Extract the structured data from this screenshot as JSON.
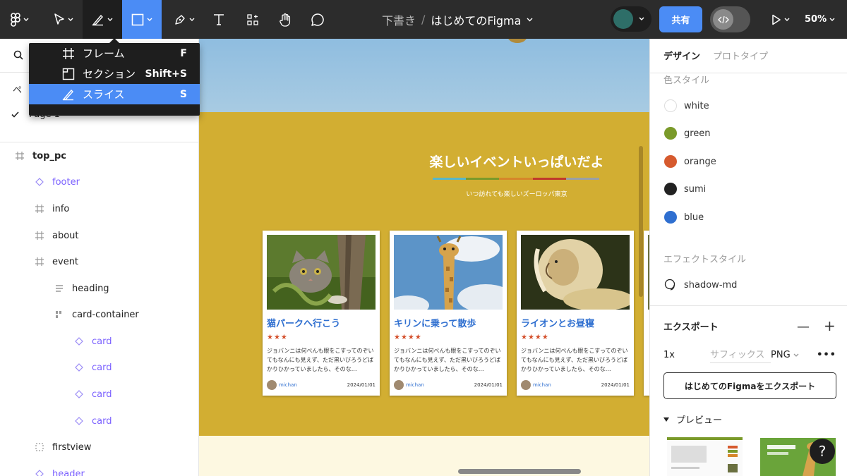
{
  "toolbar": {
    "breadcrumb_draft": "下書き",
    "breadcrumb_sep": "/",
    "file_name": "はじめてのFigma",
    "share_label": "共有",
    "zoom": "50%"
  },
  "tool_menu": {
    "items": [
      {
        "label": "フレーム",
        "shortcut": "F",
        "icon": "frame-icon"
      },
      {
        "label": "セクション",
        "shortcut": "Shift+S",
        "icon": "section-icon"
      },
      {
        "label": "スライス",
        "shortcut": "S",
        "icon": "slice-icon",
        "selected": true
      }
    ]
  },
  "left_panel": {
    "pages_label": "ペ",
    "current_page": "Page 1",
    "layers": [
      {
        "name": "top_pc",
        "type": "frame"
      },
      {
        "name": "footer",
        "type": "component"
      },
      {
        "name": "info",
        "type": "frame"
      },
      {
        "name": "about",
        "type": "frame"
      },
      {
        "name": "event",
        "type": "frame"
      },
      {
        "name": "heading",
        "type": "autolayout-vertical"
      },
      {
        "name": "card-container",
        "type": "autolayout-grid"
      },
      {
        "name": "card",
        "type": "component"
      },
      {
        "name": "card",
        "type": "component"
      },
      {
        "name": "card",
        "type": "component"
      },
      {
        "name": "card",
        "type": "component"
      },
      {
        "name": "firstview",
        "type": "group"
      },
      {
        "name": "header",
        "type": "component"
      }
    ]
  },
  "canvas": {
    "event_title": "楽しいイベントいっぱいだよ",
    "event_subtitle": "いつ訪れても楽しいズーロッパ東京",
    "cards": [
      {
        "title": "猫パークへ行こう",
        "stars": "★★★",
        "body": "ジョバンニは何べんも眼をこすってのぞいてもなんにも見えず、ただ黒いびろうどばかりひかっていましたら、そのな…",
        "user": "michan",
        "date": "2024/01/01",
        "image": "kitten"
      },
      {
        "title": "キリンに乗って散歩",
        "stars": "★★★★",
        "body": "ジョバンニは何べんも眼をこすってのぞいてもなんにも見えず、ただ黒いびろうどばかりひかっていましたら、そのな…",
        "user": "michan",
        "date": "2024/01/01",
        "image": "giraffe"
      },
      {
        "title": "ライオンとお昼寝",
        "stars": "★★★★",
        "body": "ジョバンニは何べんも眼をこすってのぞいてもなんにも見えず、ただ黒いびろうどばかりひかっていましたら、そのな…",
        "user": "michan",
        "date": "2024/01/01",
        "image": "lion"
      }
    ]
  },
  "right_panel": {
    "tab_design": "デザイン",
    "tab_prototype": "プロトタイプ",
    "color_styles_label": "色スタイル",
    "colors": [
      {
        "name": "white",
        "hex": "#ffffff"
      },
      {
        "name": "green",
        "hex": "#7a9a2a"
      },
      {
        "name": "orange",
        "hex": "#d65a2e"
      },
      {
        "name": "sumi",
        "hex": "#222222"
      },
      {
        "name": "blue",
        "hex": "#2f6fd0"
      }
    ],
    "effect_styles_label": "エフェクトスタイル",
    "effect_name": "shadow-md",
    "export_label": "エクスポート",
    "export_scale": "1x",
    "export_suffix_placeholder": "サフィックス",
    "export_format": "PNG",
    "export_button": "はじめてのFigmaをエクスポート",
    "preview_label": "プレビュー"
  },
  "help_label": "?"
}
